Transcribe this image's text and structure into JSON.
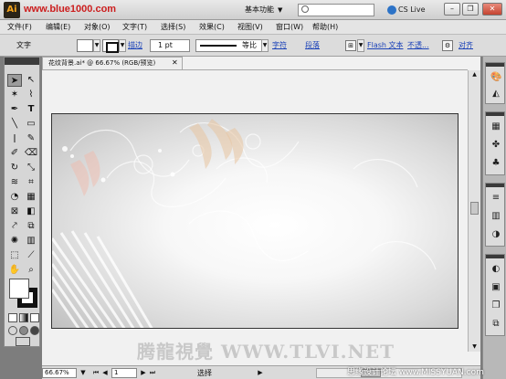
{
  "titlebar": {
    "logo": "Ai",
    "url_watermark": "www.blue1000.com",
    "workspace": "基本功能",
    "cslive": "CS Live",
    "icons": [
      "ai-logo-icon",
      "search-icon",
      "minimize-icon",
      "restore-icon",
      "close-icon"
    ]
  },
  "menu": [
    "文件(F)",
    "编辑(E)",
    "对象(O)",
    "文字(T)",
    "选择(S)",
    "效果(C)",
    "视图(V)",
    "窗口(W)",
    "帮助(H)"
  ],
  "control_bar": {
    "tool_name": "文字",
    "stroke_label": "描边",
    "stroke_weight": "1 pt",
    "stroke_profile": "等比",
    "char_link": "字符",
    "para_link": "段落",
    "flash_text": "Flash 文本",
    "opacity_link": "不透...",
    "align_link": "对齐"
  },
  "document": {
    "tab_title": "花纹背景.ai* @ 66.67% (RGB/预览)",
    "watermark": "腾龍視覺 WWW.TLVI.NET"
  },
  "status_bar": {
    "zoom": "66.67%",
    "page": "1",
    "mode": "选择"
  },
  "site_mark": "思缘设计论坛 www.MISSYUAN.com",
  "colors": {
    "link": "#1b42b8",
    "artboard_edge": "#bcbcbc",
    "workspace_bg": "#7d7d7d"
  }
}
